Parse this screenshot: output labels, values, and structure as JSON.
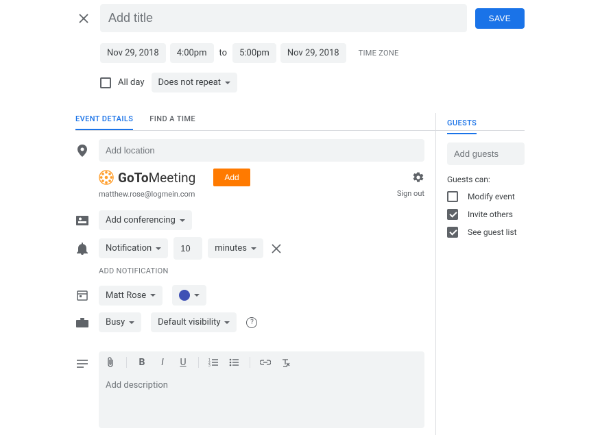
{
  "header": {
    "title_placeholder": "Add title",
    "save_label": "SAVE"
  },
  "datetime": {
    "start_date": "Nov 29, 2018",
    "start_time": "4:00pm",
    "to": "to",
    "end_time": "5:00pm",
    "end_date": "Nov 29, 2018",
    "timezone_label": "TIME ZONE",
    "all_day_label": "All day",
    "repeat_label": "Does not repeat"
  },
  "tabs": {
    "event_details": "EVENT DETAILS",
    "find_a_time": "FIND A TIME",
    "guests": "GUESTS"
  },
  "location": {
    "placeholder": "Add location"
  },
  "gotomeeting": {
    "brand_goto": "GoTo",
    "brand_meeting": "Meeting",
    "add_label": "Add",
    "email": "matthew.rose@logmein.com",
    "signout": "Sign out"
  },
  "conferencing": {
    "label": "Add conferencing"
  },
  "notification": {
    "type": "Notification",
    "value": "10",
    "unit": "minutes",
    "add_label": "ADD NOTIFICATION"
  },
  "calendar": {
    "owner": "Matt Rose",
    "color": "#3f51b5"
  },
  "availability": {
    "busy": "Busy",
    "visibility": "Default visibility"
  },
  "description": {
    "placeholder": "Add description"
  },
  "guests": {
    "placeholder": "Add guests",
    "can_label": "Guests can:",
    "modify": "Modify event",
    "invite": "Invite others",
    "see_list": "See guest list",
    "modify_checked": false,
    "invite_checked": true,
    "see_list_checked": true
  }
}
